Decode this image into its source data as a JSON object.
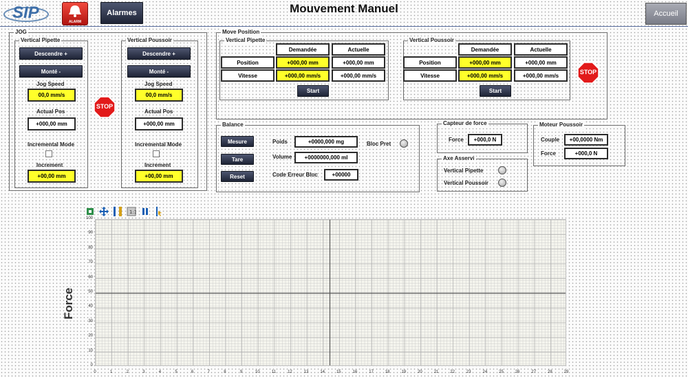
{
  "header": {
    "logo_text": "SIP",
    "alarm_text": "ALARM",
    "alarmes_label": "Alarmes",
    "title": "Mouvement Manuel",
    "accueil_label": "Accueil"
  },
  "jog": {
    "title": "JOG",
    "pipette": {
      "title": "Vertical Pipette",
      "up_label": "Descendre +",
      "down_label": "Monté -",
      "speed_label": "Jog Speed",
      "speed_value": "00,0 mm/s",
      "pos_label": "Actual Pos",
      "pos_value": "+000,00 mm",
      "mode_label": "Incremental Mode",
      "inc_label": "Increment",
      "inc_value": "+00,00 mm"
    },
    "poussoir": {
      "title": "Vertical Poussoir",
      "up_label": "Descendre +",
      "down_label": "Monté -",
      "speed_label": "Jog Speed",
      "speed_value": "00,0 mm/s",
      "pos_label": "Actual Pos",
      "pos_value": "+000,00 mm",
      "mode_label": "Incremental Mode",
      "inc_label": "Increment",
      "inc_value": "+00,00 mm"
    },
    "stop_label": "STOP"
  },
  "move": {
    "title": "Move Position",
    "pipette": {
      "title": "Vertical Pipette",
      "col_demandee": "Demandée",
      "col_actuelle": "Actuelle",
      "row_position": "Position",
      "row_vitesse": "Vitesse",
      "pos_demandee": "+000,00 mm",
      "pos_actuelle": "+000,00 mm",
      "vit_demandee": "+000,00 mm/s",
      "vit_actuelle": "+000,00 mm/s",
      "start_label": "Start"
    },
    "poussoir": {
      "title": "Vertical Poussoir",
      "col_demandee": "Demandée",
      "col_actuelle": "Actuelle",
      "row_position": "Position",
      "row_vitesse": "Vitesse",
      "pos_demandee": "+000,00 mm",
      "pos_actuelle": "+000,00 mm",
      "vit_demandee": "+000,00 mm/s",
      "vit_actuelle": "+000,00 mm/s",
      "start_label": "Start"
    },
    "stop_label": "STOP"
  },
  "balance": {
    "title": "Balance",
    "mesure_label": "Mesure",
    "tare_label": "Tare",
    "reset_label": "Reset",
    "poids_label": "Poids",
    "poids_value": "+0000,000 mg",
    "volume_label": "Volume",
    "volume_value": "+0000000,000 ml",
    "erreur_label": "Code Erreur Bloc",
    "erreur_value": "+00000",
    "bloc_pret_label": "Bloc Pret"
  },
  "capteur": {
    "title": "Capteur de force",
    "force_label": "Force",
    "force_value": "+000,0 N"
  },
  "moteur": {
    "title": "Moteur Poussoir",
    "couple_label": "Couple",
    "couple_value": "+00,0000 Nm",
    "force_label": "Force",
    "force_value": "+000,0 N"
  },
  "axe": {
    "title": "Axe Asservi",
    "pipette_label": "Vertical Pipette",
    "poussoir_label": "Vertical Poussoir"
  },
  "chart": {
    "y_axis_label": "Force",
    "toolbar": [
      "zoom-icon",
      "pan-icon",
      "autoscale-icon",
      "fit-icon",
      "pause-icon",
      "cursor-icon"
    ],
    "y_ticks": [
      "100",
      "90",
      "80",
      "70",
      "60",
      "50",
      "40",
      "30",
      "20",
      "10",
      "0"
    ],
    "x_ticks": [
      "0",
      "1",
      "2",
      "3",
      "4",
      "5",
      "6",
      "7",
      "8",
      "9",
      "10",
      "11",
      "12",
      "13",
      "14",
      "15",
      "16",
      "17",
      "18",
      "19",
      "20",
      "21",
      "22",
      "23",
      "24",
      "25",
      "26",
      "27",
      "28",
      "29"
    ],
    "colors": {
      "grid": "#c8c8c8",
      "cursor": "#555555",
      "plot_bg": "#f5f5ee"
    }
  }
}
